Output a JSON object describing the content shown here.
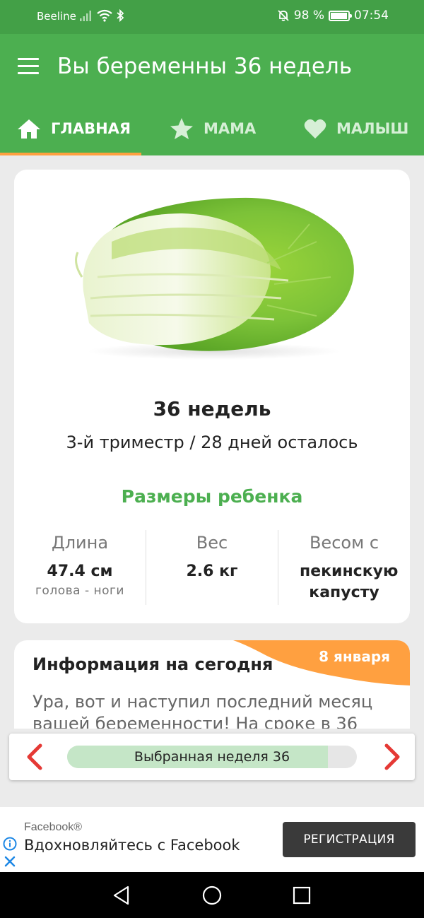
{
  "status_bar": {
    "carrier": "Beeline",
    "battery_percent": "98 %",
    "battery_level": 0.98,
    "time": "07:54",
    "icons": [
      "signal-icon",
      "wifi-icon",
      "bluetooth-icon",
      "mute-bell-icon",
      "battery-icon"
    ]
  },
  "app_bar": {
    "title": "Вы беременны 36 недель",
    "menu_icon": "menu-icon"
  },
  "tabs": [
    {
      "label": "ГЛАВНАЯ",
      "icon": "home-icon",
      "active": true
    },
    {
      "label": "МАМА",
      "icon": "star-icon",
      "active": false
    },
    {
      "label": "МАЛЫШ",
      "icon": "heart-icon",
      "active": false
    }
  ],
  "main_card": {
    "image": "chinese-cabbage-image",
    "week_title": "36 недель",
    "week_subtitle": "3-й триместр / 28 дней осталось",
    "sizes_title": "Размеры ребенка",
    "sizes": [
      {
        "label": "Длина",
        "value": "47.4 см",
        "note": "голова - ноги"
      },
      {
        "label": "Вес",
        "value": "2.6 кг",
        "note": ""
      },
      {
        "label": "Весом с",
        "value": "пекинскую капусту",
        "note": ""
      }
    ]
  },
  "info_card": {
    "date": "8 января",
    "title": "Информация на сегодня",
    "text": "Ура, вот и наступил последний месяц вашей беременности! На сроке в 36"
  },
  "week_selector": {
    "label": "Выбранная неделя 36",
    "progress": 0.9,
    "prev_icon": "chevron-left-icon",
    "next_icon": "chevron-right-icon"
  },
  "ad": {
    "brand": "Facebook®",
    "text": "Вдохновляйтесь с Facebook",
    "button": "РЕГИСТРАЦИЯ"
  },
  "colors": {
    "primary": "#4caf50",
    "status_bar": "#43a047",
    "accent": "#ffa040",
    "arrow": "#e53935",
    "progress_fill": "#c5e6c7"
  }
}
